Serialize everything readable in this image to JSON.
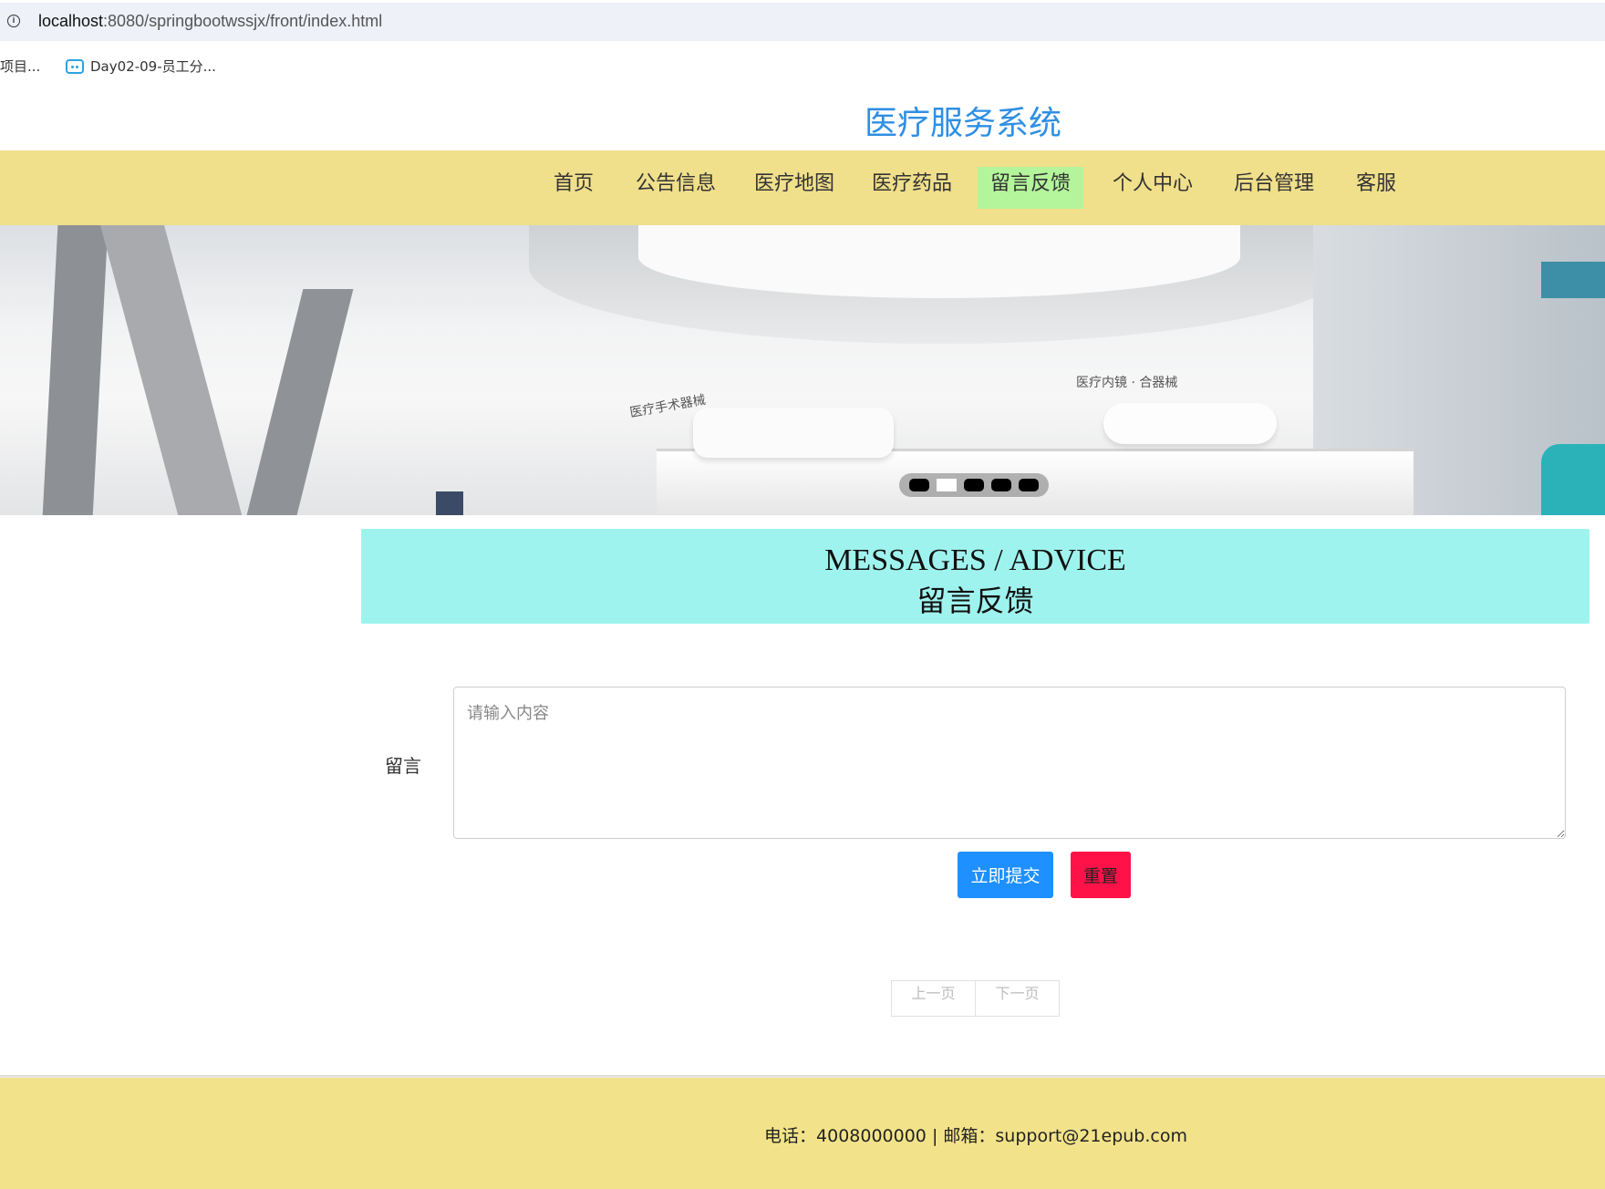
{
  "browser": {
    "url_host": "localhost",
    "url_rest": ":8080/springbootwssjx/front/index.html",
    "bookmarks": [
      "项目...",
      "Day02-09-员工分..."
    ]
  },
  "site": {
    "title": "医疗服务系统"
  },
  "nav": {
    "items": [
      "首页",
      "公告信息",
      "医疗地图",
      "医疗药品",
      "留言反馈",
      "个人中心",
      "后台管理",
      "客服"
    ],
    "active_index": 4
  },
  "banner": {
    "wall_text_left": "医疗手术器械",
    "wall_text_right": "医疗内镜 · 合器械",
    "slide_count": 5,
    "active_slide": 1
  },
  "section": {
    "title_en": "MESSAGES / ADVICE",
    "title_cn": "留言反馈"
  },
  "form": {
    "label": "留言",
    "placeholder": "请输入内容",
    "value": "",
    "submit_label": "立即提交",
    "reset_label": "重置"
  },
  "pager": {
    "prev_label": "上一页",
    "next_label": "下一页"
  },
  "footer": {
    "contact": "电话：4008000000 | 邮箱：support@21epub.com"
  },
  "colors": {
    "nav_bg": "#f0df8b",
    "nav_active": "#b4f59b",
    "title_blue": "#2f8fe3",
    "section_bg": "#9ff3ee",
    "submit_bg": "#1e90ff",
    "reset_bg": "#ff1248",
    "footer_bg": "#f2e38a"
  }
}
